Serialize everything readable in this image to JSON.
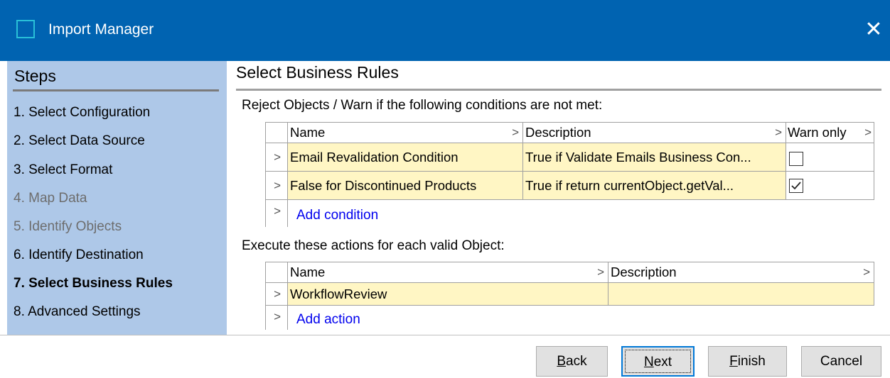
{
  "window": {
    "title": "Import Manager",
    "close_glyph": "✕"
  },
  "steps": {
    "title": "Steps",
    "items": [
      {
        "label": "1. Select Configuration",
        "state": "normal"
      },
      {
        "label": "2. Select Data Source",
        "state": "normal"
      },
      {
        "label": "3. Select Format",
        "state": "normal"
      },
      {
        "label": "4. Map Data",
        "state": "disabled"
      },
      {
        "label": "5. Identify Objects",
        "state": "disabled"
      },
      {
        "label": "6. Identify Destination",
        "state": "normal"
      },
      {
        "label": "7. Select Business Rules",
        "state": "active"
      },
      {
        "label": "8. Advanced Settings",
        "state": "normal"
      }
    ]
  },
  "main": {
    "title": "Select Business Rules",
    "conditions": {
      "label": "Reject Objects / Warn if the following conditions are not met:",
      "headers": {
        "name": "Name",
        "description": "Description",
        "warn_only": "Warn only"
      },
      "rows": [
        {
          "name": "Email Revalidation Condition",
          "description": "True if Validate Emails Business Con...",
          "warn_only": false
        },
        {
          "name": "False for Discontinued Products",
          "description": "True if return currentObject.getVal...",
          "warn_only": true
        }
      ],
      "add_label": "Add condition"
    },
    "actions": {
      "label": "Execute these actions for each valid Object:",
      "headers": {
        "name": "Name",
        "description": "Description"
      },
      "rows": [
        {
          "name": "WorkflowReview",
          "description": ""
        }
      ],
      "add_label": "Add action"
    }
  },
  "footer": {
    "back": {
      "label": "Back",
      "mnemonic": "B",
      "rest": "ack"
    },
    "next": {
      "label": "Next",
      "mnemonic": "N",
      "rest": "ext"
    },
    "finish": {
      "label": "Finish",
      "mnemonic": "F",
      "rest": "inish"
    },
    "cancel": {
      "label": "Cancel"
    }
  },
  "colors": {
    "titlebar": "#0063b1",
    "steps_panel": "#aec8e8",
    "row_highlight": "#fff6c4",
    "link": "#0000ee",
    "default_button_border": "#0078d7"
  },
  "icons": {
    "app": "app-window-icon",
    "close": "close-icon",
    "row_expand": "chevron-right-icon",
    "column_menu": "chevron-right-icon",
    "checked": "checkmark-icon"
  }
}
